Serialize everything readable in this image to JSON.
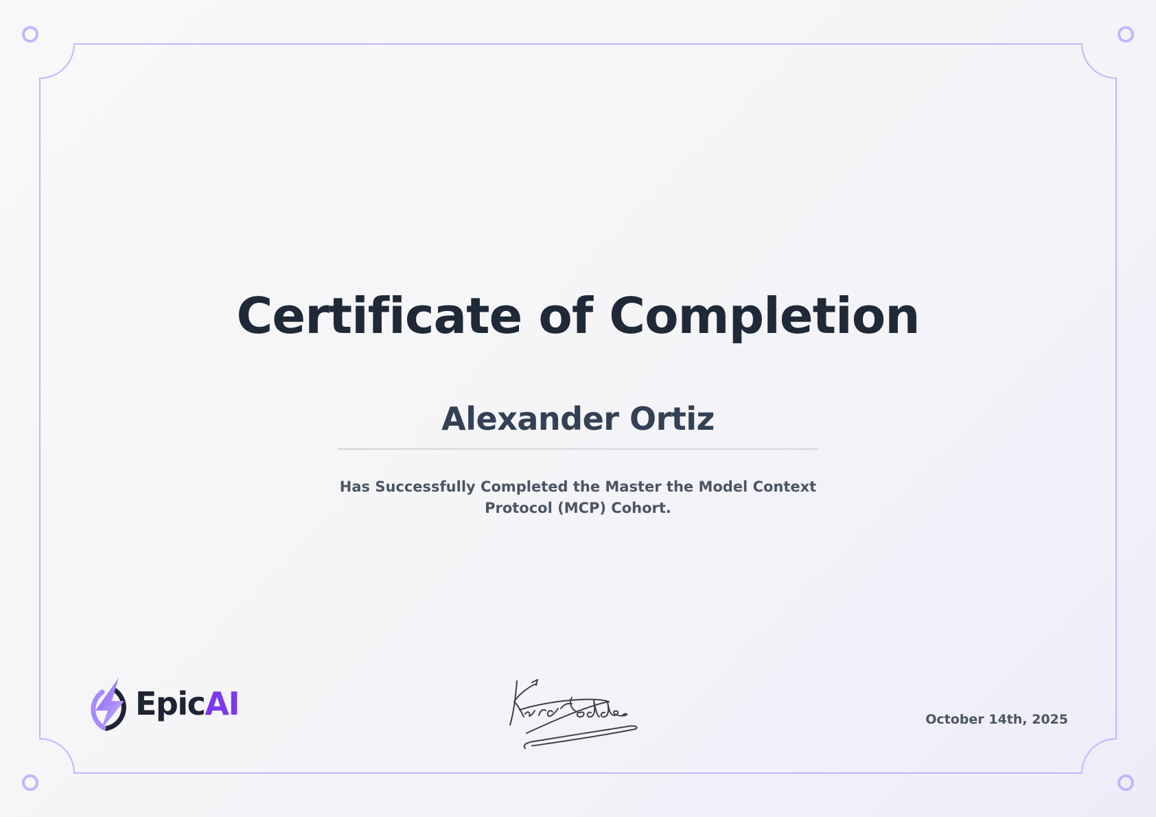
{
  "certificate": {
    "title": "Certificate of Completion",
    "recipient_name": "Alexander Ortiz",
    "description": "Has Successfully Completed the Master the Model Context Protocol (MCP) Cohort.",
    "date": "October 14th, 2025"
  },
  "brand": {
    "logo_icon": "lightning-bolt-icon",
    "name_part1": "Epic",
    "name_part2": "AI",
    "accent_color": "#7c3aed"
  },
  "colors": {
    "border": "#c4b5fd",
    "title": "#1f2937",
    "text": "#4b5563"
  }
}
